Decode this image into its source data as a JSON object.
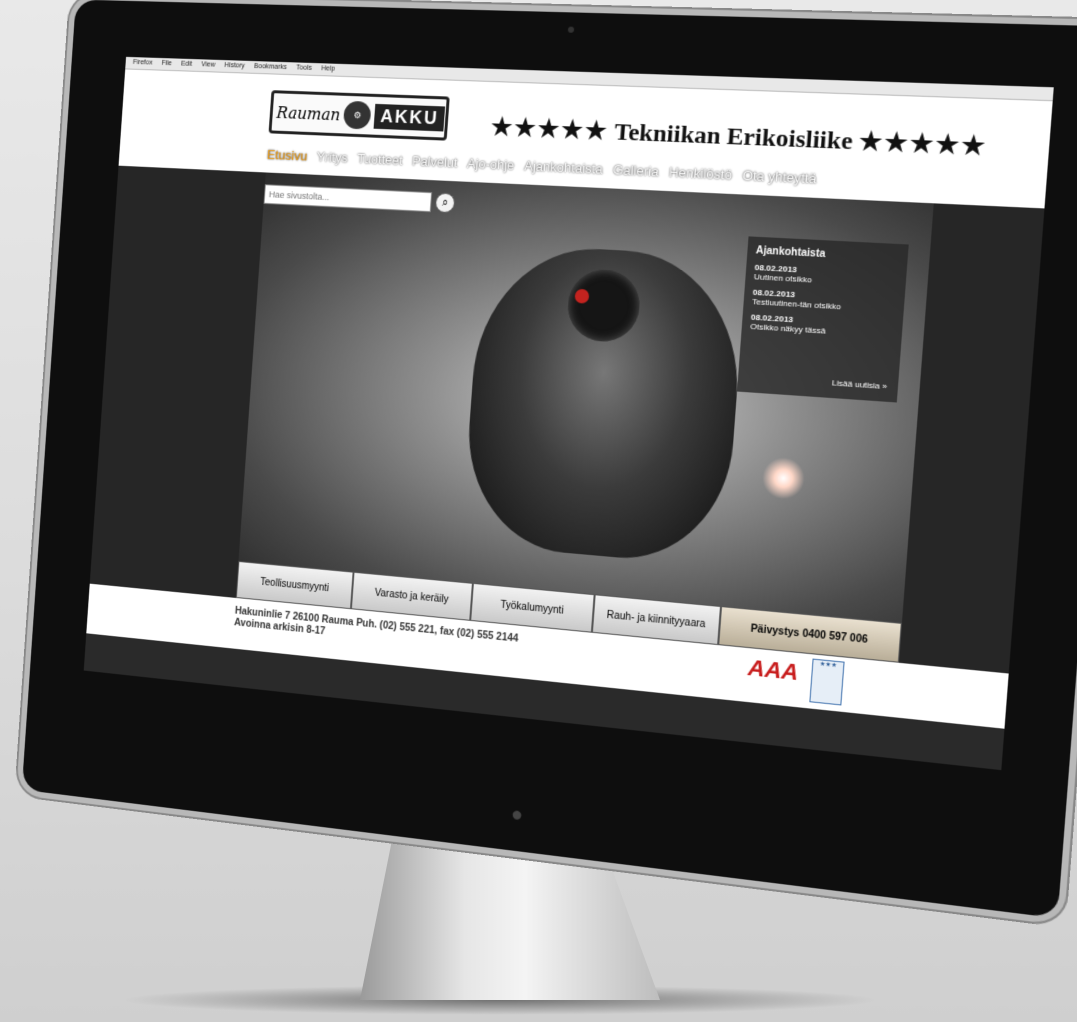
{
  "menubar": {
    "items": [
      "Firefox",
      "File",
      "Edit",
      "View",
      "History",
      "Bookmarks",
      "Tools",
      "Help"
    ]
  },
  "logo": {
    "script": "Rauman",
    "brand": "AKKU"
  },
  "tagline": {
    "stars_left": "★★★★★",
    "text": "Tekniikan Erikoisliike",
    "stars_right": "★★★★★"
  },
  "nav": {
    "items": [
      "Etusivu",
      "Yritys",
      "Tuotteet",
      "Palvelut",
      "Ajo-ohje",
      "Ajankohtaista",
      "Galleria",
      "Henkilöstö",
      "Ota yhteyttä"
    ],
    "active": "Etusivu"
  },
  "search": {
    "placeholder": "Hae sivustolta..."
  },
  "news": {
    "title": "Ajankohtaista",
    "items": [
      {
        "date": "08.02.2013",
        "text": "Uutinen otsikko"
      },
      {
        "date": "08.02.2013",
        "text": "Testiuutinen-tän otsikko"
      },
      {
        "date": "08.02.2013",
        "text": "Otsikko näkyy tässä"
      }
    ],
    "more": "Lisää uutisia »"
  },
  "tabs": [
    "Teollisuusmyynti",
    "Varasto ja keräily",
    "Työkalumyynti",
    "Rauh- ja kiinnityyaara"
  ],
  "cta": "Päivystys 0400 597 006",
  "footer": {
    "address_line1": "Hakuninlie 7 26100 Rauma Puh. (02) 555 221, fax (02) 555 2144",
    "address_line2": "Avoinna arkisin 8-17",
    "aaa": "AAA"
  },
  "colors": {
    "accent": "#e89b1a",
    "red_band": "#c5121a"
  }
}
